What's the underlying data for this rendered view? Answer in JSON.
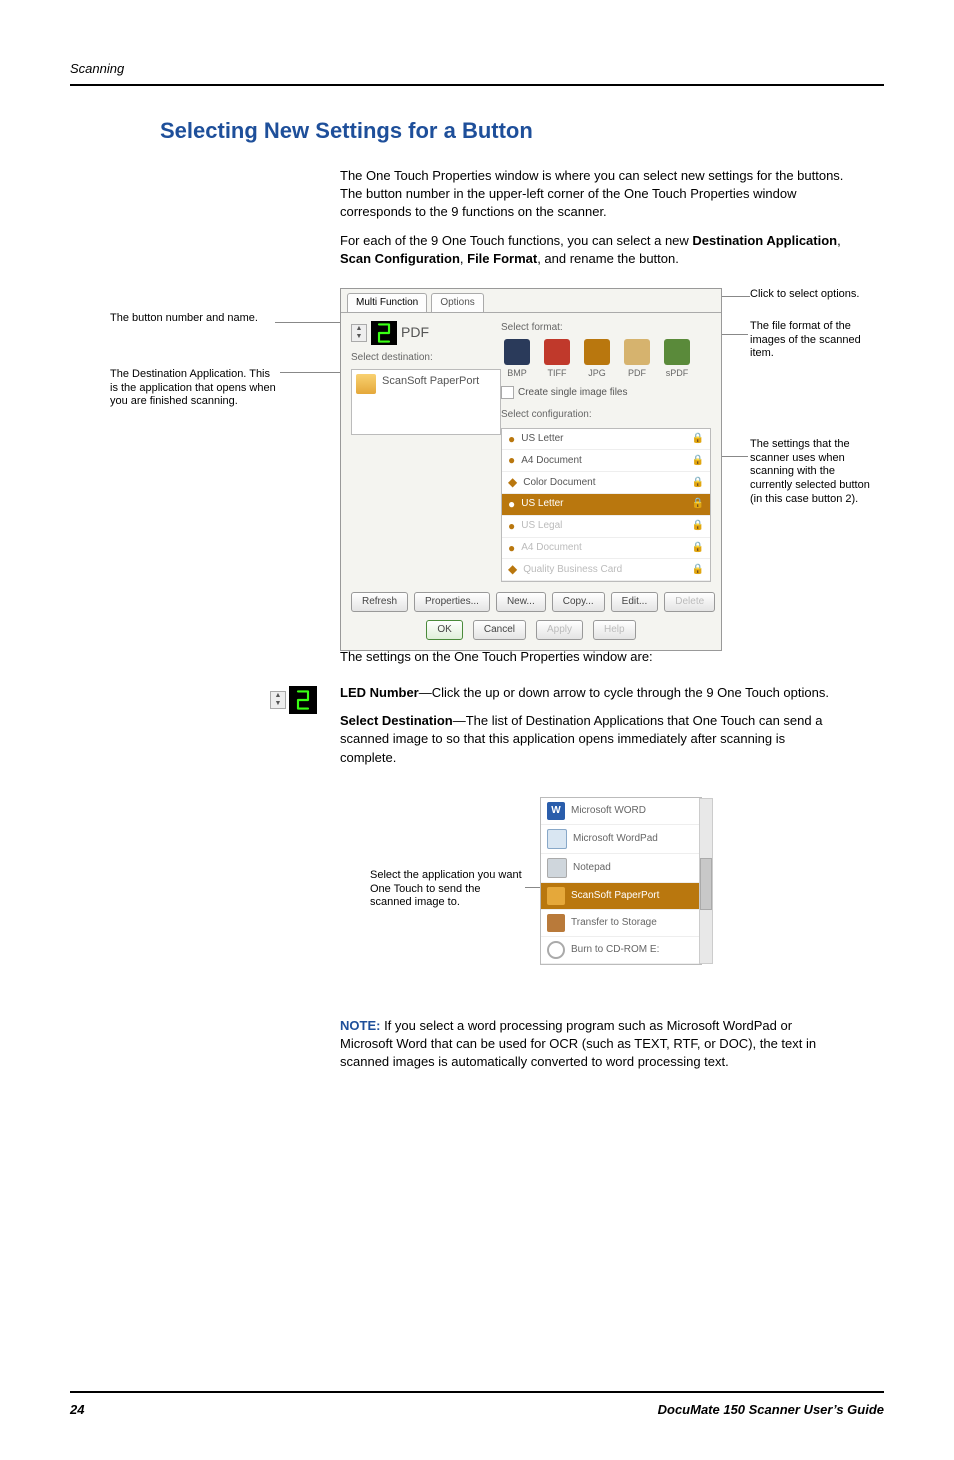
{
  "header_running": "Scanning",
  "section_title": "Selecting New Settings for a Button",
  "intro": {
    "p1": "The One Touch Properties window is where you can select new settings for the buttons. The button number in the upper-left corner of the One Touch Properties window corresponds to the 9 functions on the scanner.",
    "p2_prefix": "For each of the 9 One Touch functions, you can select a new ",
    "p2_b1": "Destination Application",
    "p2_mid1": ", ",
    "p2_b2": "Scan Configuration",
    "p2_mid2": ", ",
    "p2_b3": "File Format",
    "p2_suffix": ", and rename the button."
  },
  "annotations": {
    "button_name": "The button number and name.",
    "dest_app": "The Destination Application. This is the application that opens when you are finished scanning.",
    "click_opts": "Click to select options.",
    "file_format": "The file format of the images of the scanned item.",
    "settings": "The settings that the scanner uses when scanning with the currently selected button (in this case button 2)."
  },
  "dialog": {
    "tabs": [
      "Multi Function",
      "Options"
    ],
    "led_label": "PDF",
    "select_dest_label": "Select destination:",
    "dest_app": "ScanSoft PaperPort",
    "select_format_label": "Select format:",
    "formats": [
      "BMP",
      "TIFF",
      "JPG",
      "PDF",
      "sPDF"
    ],
    "create_single": "Create single image files",
    "select_config_label": "Select configuration:",
    "cfgs": [
      {
        "name": "US Letter",
        "icon": "●",
        "selected": false,
        "dim": false
      },
      {
        "name": "A4 Document",
        "icon": "●",
        "selected": false,
        "dim": false
      },
      {
        "name": "Color Document",
        "icon": "◆",
        "selected": false,
        "dim": false
      },
      {
        "name": "US Letter",
        "icon": "●",
        "selected": true,
        "dim": false
      },
      {
        "name": "US Legal",
        "icon": "●",
        "selected": false,
        "dim": true
      },
      {
        "name": "A4 Document",
        "icon": "●",
        "selected": false,
        "dim": true
      },
      {
        "name": "Quality Business Card",
        "icon": "◆",
        "selected": false,
        "dim": true
      }
    ],
    "buttons_row1_left": [
      "Refresh",
      "Properties..."
    ],
    "buttons_row1_right": [
      "New...",
      "Copy...",
      "Edit...",
      "Delete"
    ],
    "buttons_row2": [
      "OK",
      "Cancel",
      "Apply",
      "Help"
    ]
  },
  "body2": {
    "p1": "The settings on the One Touch Properties window are:",
    "led_b": "LED Number",
    "led_t": "—Click the up or down arrow to cycle through the 9 One Touch options.",
    "sd_b": "Select Destination",
    "sd_t": "—The list of Destination Applications that One Touch can send a scanned image to so that this application opens immediately after scanning is complete."
  },
  "dest_fig": {
    "annot": "Select the application you want One Touch to send the scanned image to.",
    "rows": [
      "Microsoft WORD",
      "Microsoft WordPad",
      "Notepad",
      "ScanSoft PaperPort",
      "Transfer to Storage",
      "Burn to CD-ROM  E:"
    ],
    "selected_index": 3
  },
  "note": {
    "label": "NOTE:",
    "text": "  If you select a word processing program such as Microsoft WordPad or Microsoft Word that can be used for OCR (such as TEXT, RTF, or DOC), the text in scanned images is automatically converted to word processing text."
  },
  "footer": {
    "page": "24",
    "guide": "DocuMate 150 Scanner User’s Guide"
  }
}
